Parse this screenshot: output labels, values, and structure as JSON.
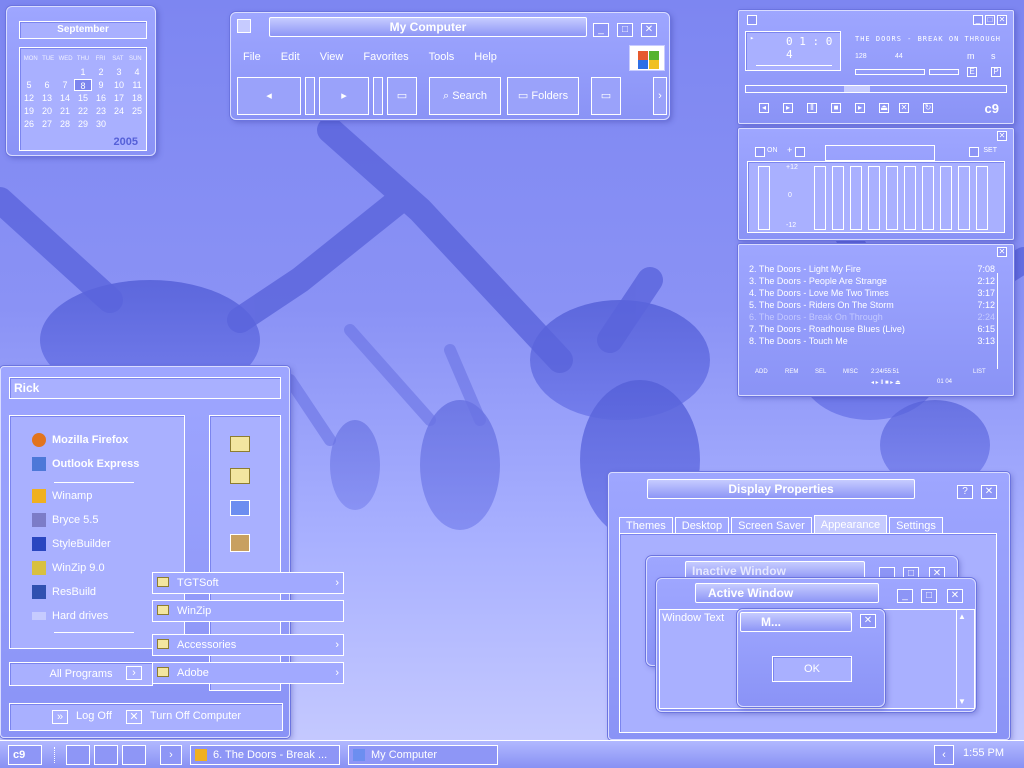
{
  "calendar": {
    "month": "September",
    "weekdays": [
      "MON",
      "TUE",
      "WED",
      "THU",
      "FRI",
      "SAT",
      "SUN"
    ],
    "dates": [
      "",
      "",
      "",
      "1",
      "2",
      "3",
      "4",
      "5",
      "6",
      "7",
      "8",
      "9",
      "10",
      "11",
      "12",
      "13",
      "14",
      "15",
      "16",
      "17",
      "18",
      "19",
      "20",
      "21",
      "22",
      "23",
      "24",
      "25",
      "26",
      "27",
      "28",
      "29",
      "30",
      "",
      ""
    ],
    "today": "8",
    "year": "2005"
  },
  "my_computer": {
    "title": "My Computer",
    "menu": [
      "File",
      "Edit",
      "View",
      "Favorites",
      "Tools",
      "Help"
    ],
    "toolbar": {
      "search": "Search",
      "folders": "Folders"
    }
  },
  "winamp": {
    "time": "0 1 : 0 4",
    "song_scroll": "THE DOORS - BREAK ON THROUGH",
    "kbps": "128",
    "khz": "44",
    "mono": "m",
    "stereo": "s",
    "eq_toggle": "E",
    "pl_toggle": "P",
    "logo": "c9",
    "eq_on": "ON",
    "eq_auto": "+",
    "eq_set": "SET",
    "eq_top": "+12",
    "eq_mid": "0",
    "eq_bottom": "-12"
  },
  "playlist": {
    "items": [
      {
        "title": "2. The Doors - Light My Fire",
        "time": "7:08"
      },
      {
        "title": "3. The Doors - People Are Strange",
        "time": "2:12"
      },
      {
        "title": "4. The Doors - Love Me Two Times",
        "time": "3:17"
      },
      {
        "title": "5. The Doors - Riders On The Storm",
        "time": "7:12"
      },
      {
        "title": "6. The Doors - Break On Through",
        "time": "2:24"
      },
      {
        "title": "7. The Doors - Roadhouse Blues (Live)",
        "time": "6:15"
      },
      {
        "title": "8. The Doors - Touch Me",
        "time": "3:13"
      }
    ],
    "current_index": 4,
    "buttons": {
      "add": "ADD",
      "rem": "REM",
      "sel": "SEL",
      "misc": "MISC",
      "list": "LIST"
    },
    "total_time": "2:24/55:51",
    "mini_time": "01 04"
  },
  "start_menu": {
    "user": "Rick",
    "pinned": [
      "Mozilla Firefox",
      "Outlook Express"
    ],
    "recent": [
      "Winamp",
      "Bryce 5.5",
      "StyleBuilder",
      "WinZip 9.0",
      "ResBuild",
      "Hard drives"
    ],
    "all_programs": "All Programs",
    "log_off": "Log Off",
    "turn_off": "Turn Off Computer"
  },
  "submenu": {
    "items": [
      {
        "label": "TGTSoft",
        "has_sub": true
      },
      {
        "label": "WinZip",
        "has_sub": false
      },
      {
        "label": "Accessories",
        "has_sub": true
      },
      {
        "label": "Adobe",
        "has_sub": true
      }
    ]
  },
  "display_properties": {
    "title": "Display Properties",
    "help": "?",
    "tabs": [
      "Themes",
      "Desktop",
      "Screen Saver",
      "Appearance",
      "Settings"
    ],
    "active_tab": "Appearance",
    "inactive_window": "Inactive Window",
    "active_window": "Active Window",
    "window_text": "Window Text",
    "message_box": "M...",
    "ok": "OK"
  },
  "taskbar": {
    "start": "c9",
    "tasks": [
      {
        "label": "6. The Doors - Break ..."
      },
      {
        "label": "My Computer"
      }
    ],
    "clock": "1:55 PM"
  },
  "colors": {
    "accent": "#8a92f5",
    "highlight": "#c6cbff",
    "border": "#ffffff"
  }
}
